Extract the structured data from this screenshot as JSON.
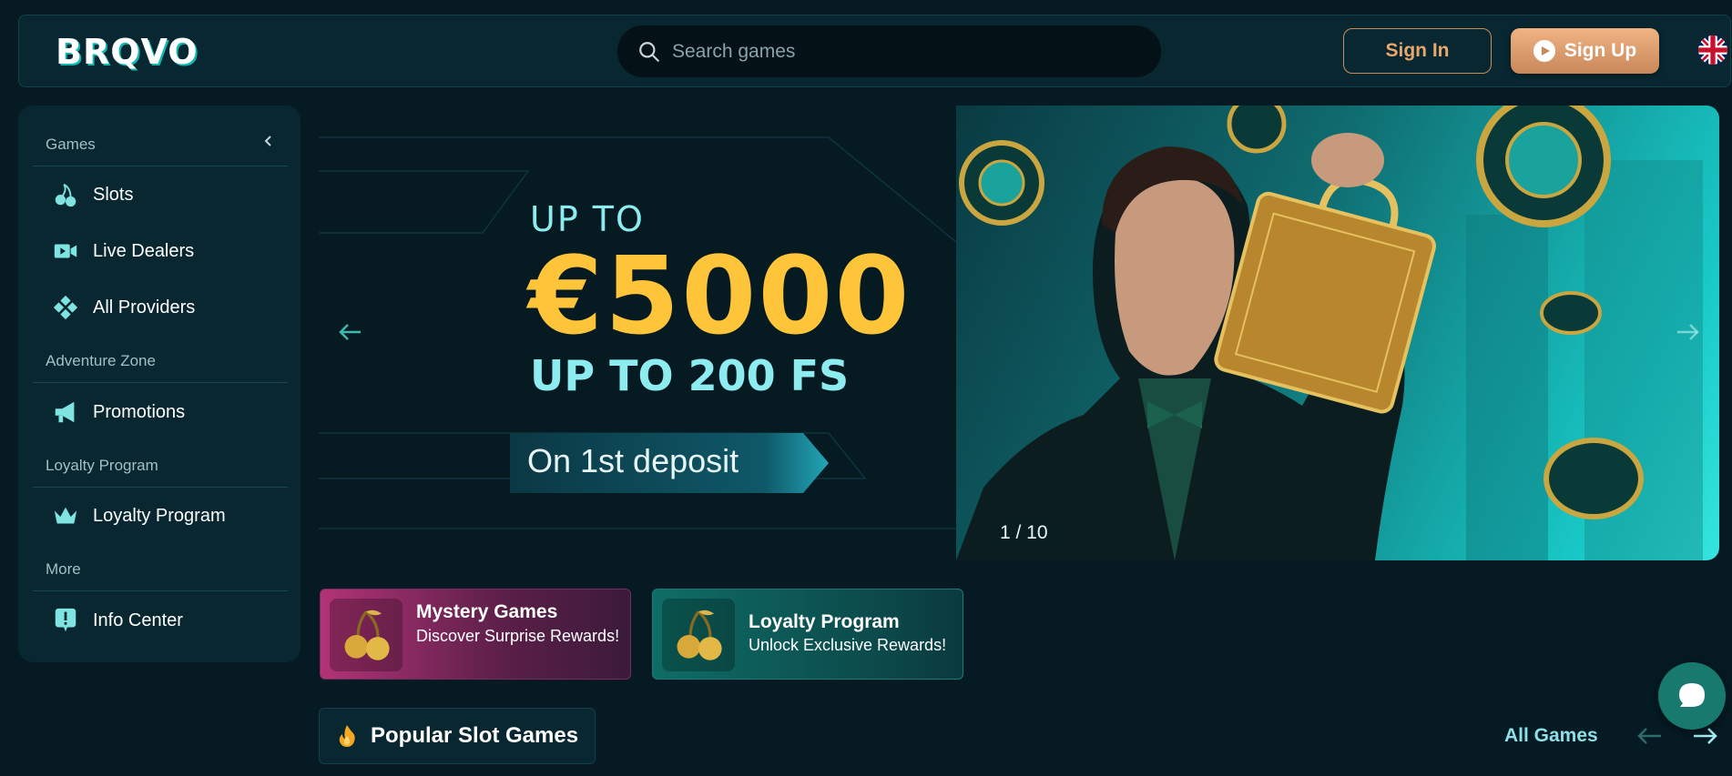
{
  "header": {
    "logo": "BRQVO",
    "search_placeholder": "Search games",
    "signin_label": "Sign In",
    "signup_label": "Sign Up",
    "language_flag": "uk-flag-icon"
  },
  "sidebar": {
    "games_heading": "Games",
    "items_games": [
      {
        "label": "Slots",
        "icon": "cherries-icon"
      },
      {
        "label": "Live Dealers",
        "icon": "video-camera-icon"
      },
      {
        "label": "All Providers",
        "icon": "diamonds-grid-icon"
      }
    ],
    "adventure_heading": "Adventure Zone",
    "items_adventure": [
      {
        "label": "Promotions",
        "icon": "megaphone-icon"
      }
    ],
    "loyalty_heading": "Loyalty Program",
    "items_loyalty": [
      {
        "label": "Loyalty Program",
        "icon": "crown-icon"
      }
    ],
    "more_heading": "More",
    "items_more": [
      {
        "label": "Info Center",
        "icon": "info-alert-icon"
      }
    ]
  },
  "banner": {
    "line1": "UP TO",
    "line2": "€5000",
    "line3": "UP TO 200 FS",
    "line4": "On 1st deposit",
    "slide_counter": "1 / 10",
    "accent_color": "#ffc53a",
    "highlight_color": "#8cecf0"
  },
  "promos": [
    {
      "title": "Mystery Games",
      "subtitle": "Discover Surprise Rewards!",
      "icon": "golden-cherries-icon"
    },
    {
      "title": "Loyalty Program",
      "subtitle": "Unlock Exclusive Rewards!",
      "icon": "golden-cherries-icon"
    }
  ],
  "popular": {
    "title": "Popular Slot Games",
    "all_games_label": "All Games"
  },
  "colors": {
    "background": "#051a22",
    "panel": "#082731",
    "accent_orange": "#e7a86d",
    "teal": "#18796f"
  }
}
